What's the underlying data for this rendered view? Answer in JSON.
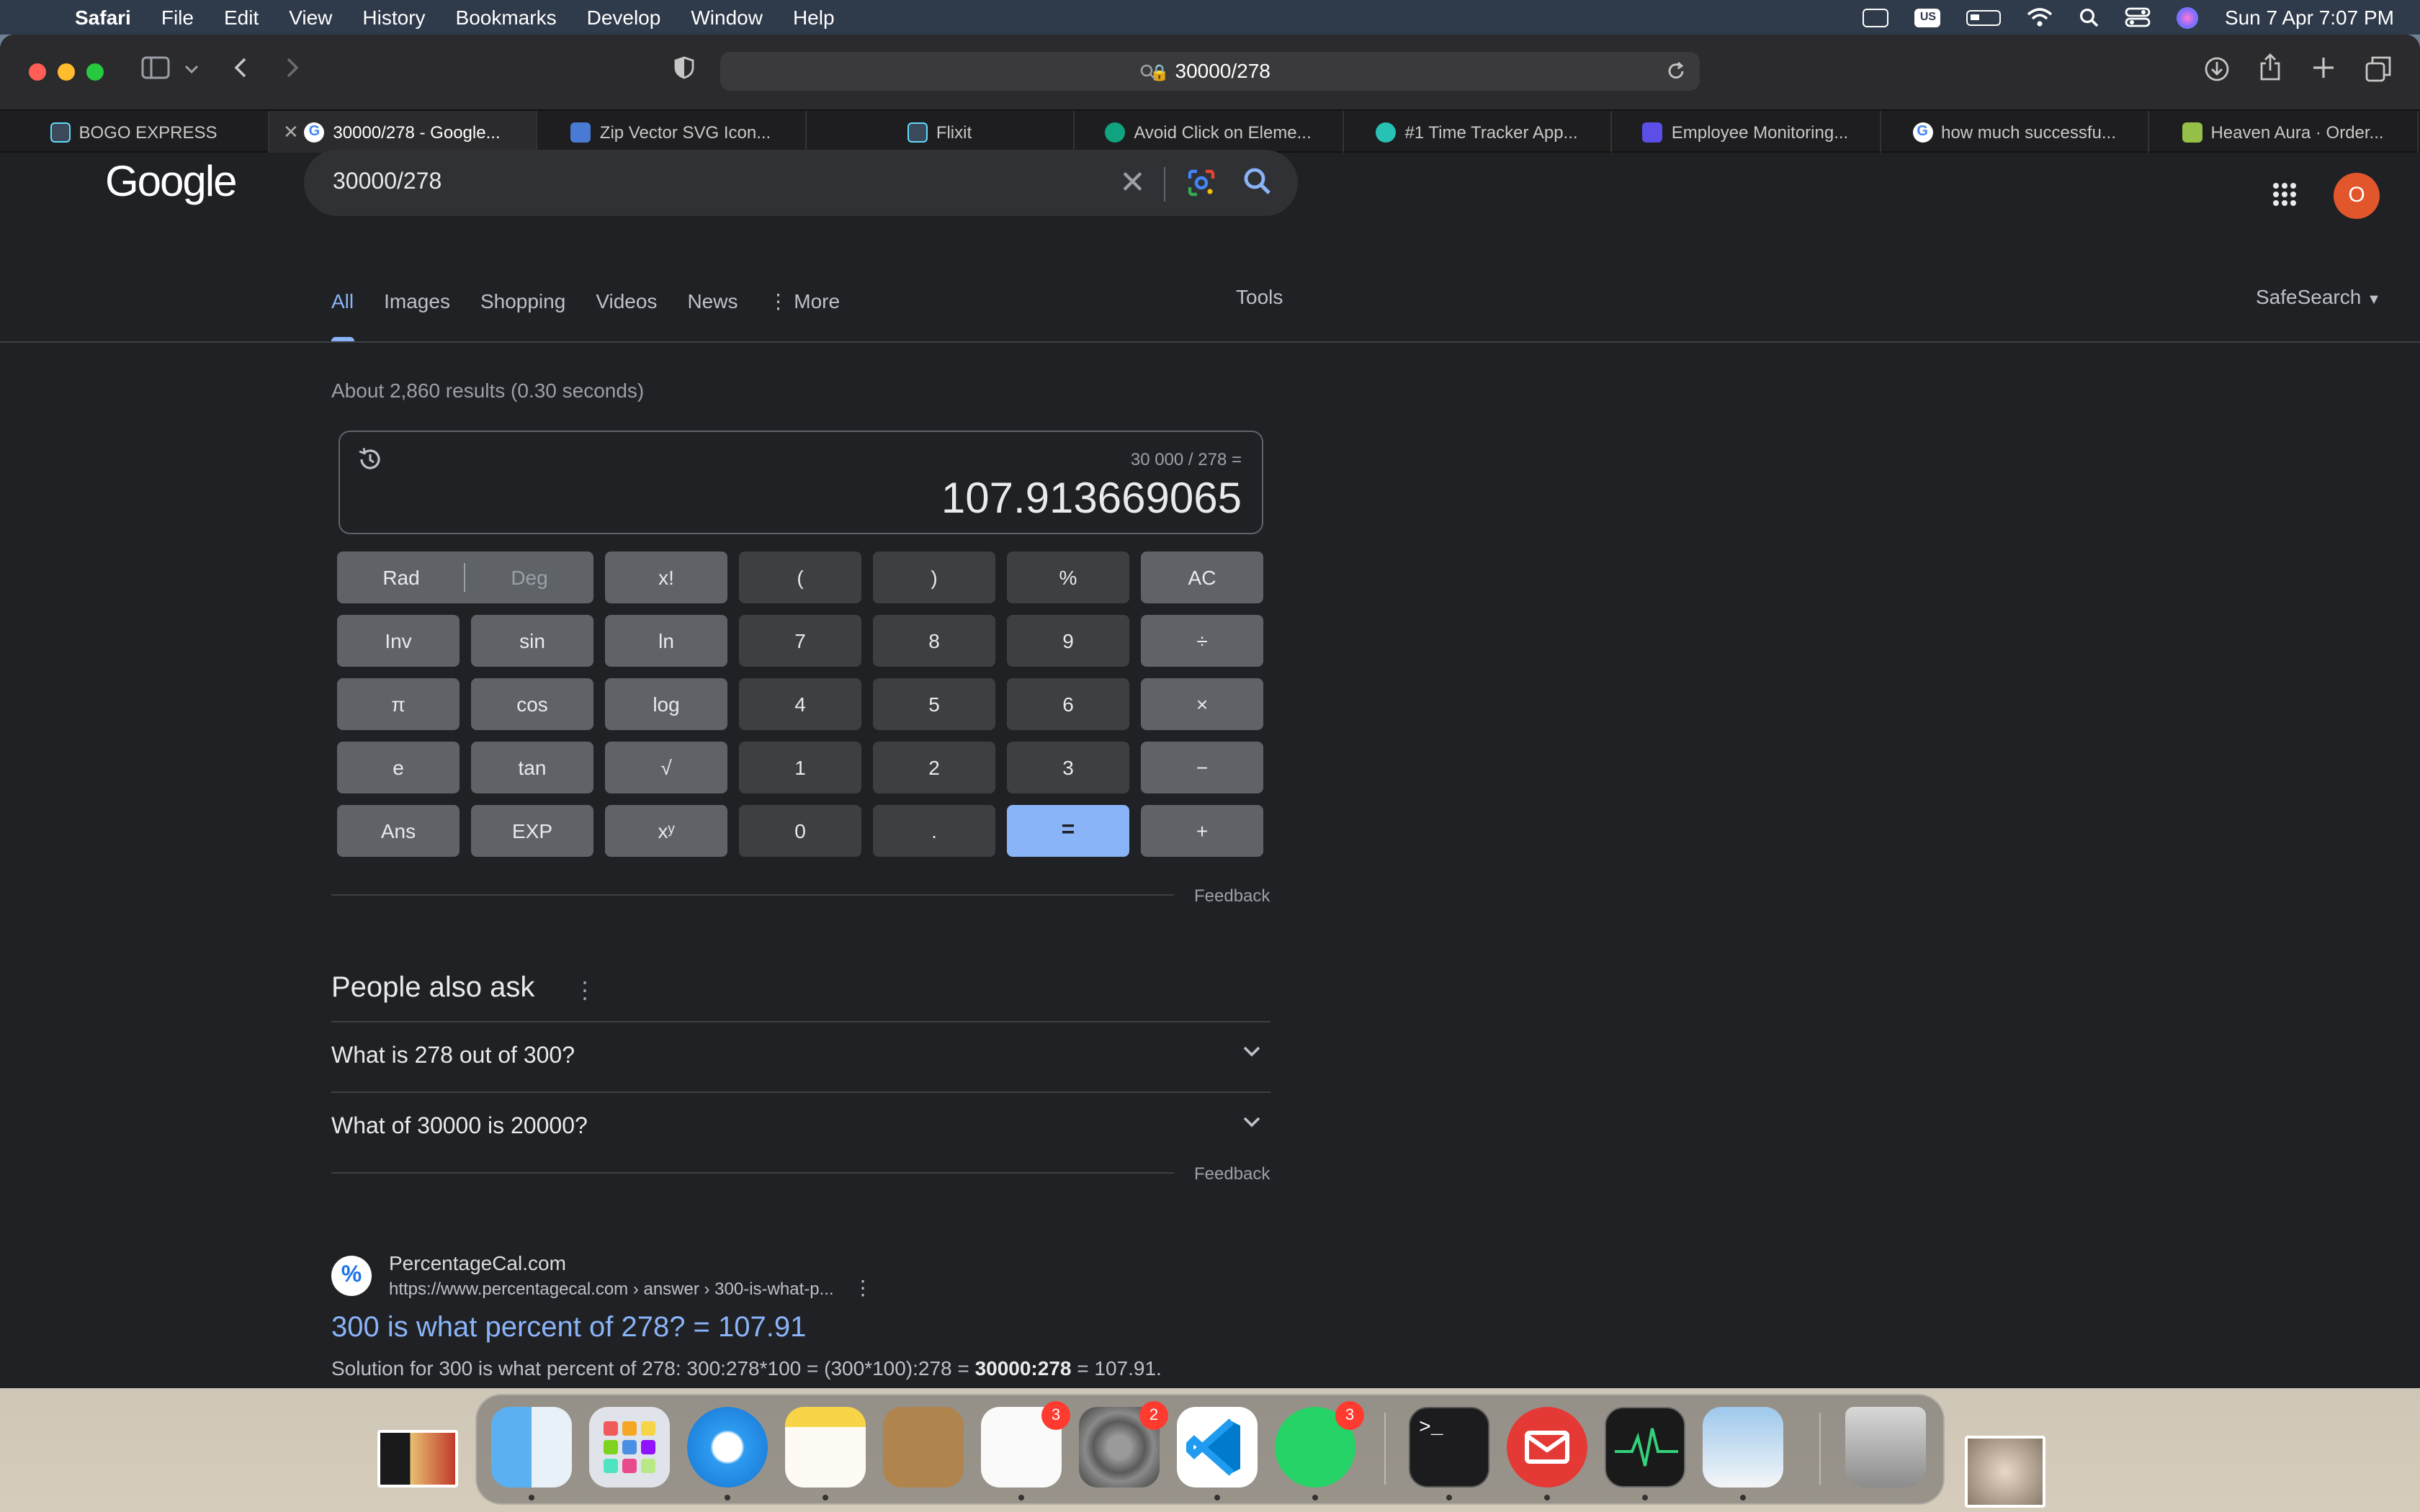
{
  "menubar": {
    "app": "Safari",
    "items": [
      "File",
      "Edit",
      "View",
      "History",
      "Bookmarks",
      "Develop",
      "Window",
      "Help"
    ],
    "input_source": "US",
    "clock": "Sun 7 Apr  7:07 PM"
  },
  "browser": {
    "address": "30000/278",
    "tabs": [
      {
        "label": "BOGO EXPRESS",
        "icon": "react-icon"
      },
      {
        "label": "30000/278 - Google...",
        "icon": "google-icon",
        "active": true
      },
      {
        "label": "Zip Vector SVG Icon...",
        "icon": "svg-icon"
      },
      {
        "label": "Flixit",
        "icon": "react-icon"
      },
      {
        "label": "Avoid Click on Eleme...",
        "icon": "openai-icon"
      },
      {
        "label": "#1 Time Tracker App...",
        "icon": "tracker-icon"
      },
      {
        "label": "Employee Monitoring...",
        "icon": "monitor-icon"
      },
      {
        "label": "how much successfu...",
        "icon": "google-icon"
      },
      {
        "label": "Heaven Aura · Order...",
        "icon": "shopify-icon"
      }
    ]
  },
  "google": {
    "logo": "Google",
    "query": "30000/278",
    "avatar_letter": "O",
    "nav": {
      "all": "All",
      "images": "Images",
      "shopping": "Shopping",
      "videos": "Videos",
      "news": "News",
      "more": "More",
      "tools": "Tools",
      "safesearch": "SafeSearch"
    },
    "stats": "About 2,860 results (0.30 seconds)"
  },
  "calculator": {
    "expression": "30 000 / 278 =",
    "result": "107.913669065",
    "rad": "Rad",
    "deg": "Deg",
    "keys": [
      [
        "x!",
        "(",
        ")",
        "%",
        "AC"
      ],
      [
        "Inv",
        "sin",
        "ln",
        "7",
        "8",
        "9",
        "÷"
      ],
      [
        "π",
        "cos",
        "log",
        "4",
        "5",
        "6",
        "×"
      ],
      [
        "e",
        "tan",
        "√",
        "1",
        "2",
        "3",
        "−"
      ],
      [
        "Ans",
        "EXP",
        "xʸ",
        "0",
        ".",
        "=",
        "+"
      ]
    ],
    "feedback": "Feedback"
  },
  "people_also_ask": {
    "title": "People also ask",
    "questions": [
      "What is 278 out of 300?",
      "What of 30000 is 20000?"
    ],
    "feedback": "Feedback"
  },
  "result": {
    "favicon": "%",
    "site": "PercentageCal.com",
    "url": "https://www.percentagecal.com › answer › 300-is-what-p...",
    "title": "300 is what percent of 278? = 107.91",
    "snippet_pre": "Solution for 300 is what percent of 278: 300:278*100 = (300*100):278 = ",
    "snippet_bold": "30000:278",
    "snippet_post": " = 107.91."
  },
  "dock": {
    "apps": [
      "Finder",
      "Launchpad",
      "Safari",
      "Notes",
      "Contacts",
      "Reminders",
      "System Settings",
      "Visual Studio Code",
      "WhatsApp",
      "Terminal",
      "Mail",
      "Activity Monitor",
      "Preview",
      "Trash"
    ],
    "badges": {
      "reminders": "3",
      "settings": "2",
      "whatsapp": "3"
    }
  },
  "colors": {
    "accent": "#8ab4f8",
    "page_bg": "#202124",
    "avatar": "#e2562c"
  }
}
